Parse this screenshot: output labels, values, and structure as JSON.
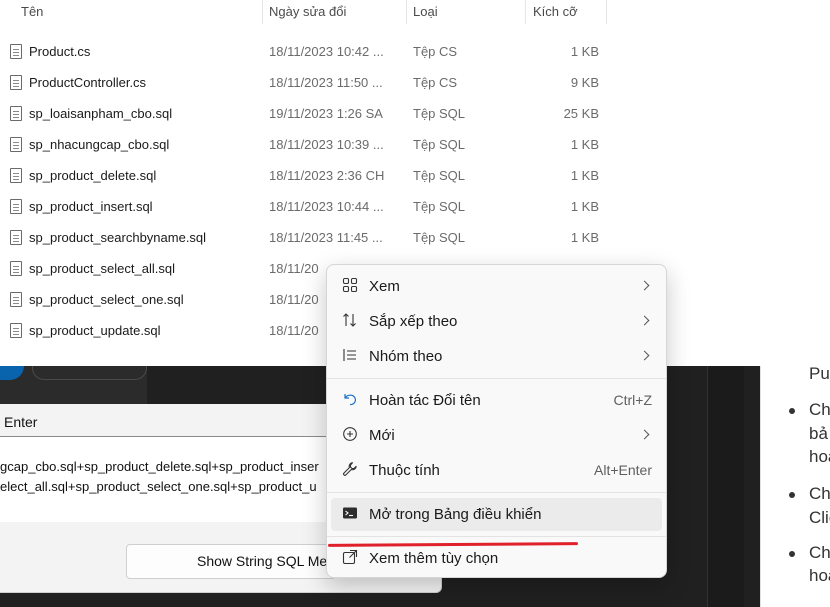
{
  "explorer": {
    "columns": {
      "name": "Tên",
      "date": "Ngày sửa đổi",
      "type": "Loại",
      "size": "Kích cỡ"
    },
    "files": [
      {
        "name": "Product.cs",
        "date": "18/11/2023 10:42 ...",
        "type": "Tệp CS",
        "size": "1 KB"
      },
      {
        "name": "ProductController.cs",
        "date": "18/11/2023 11:50 ...",
        "type": "Tệp CS",
        "size": "9 KB"
      },
      {
        "name": "sp_loaisanpham_cbo.sql",
        "date": "19/11/2023 1:26 SA",
        "type": "Tệp SQL",
        "size": "25 KB"
      },
      {
        "name": "sp_nhacungcap_cbo.sql",
        "date": "18/11/2023 10:39 ...",
        "type": "Tệp SQL",
        "size": "1 KB"
      },
      {
        "name": "sp_product_delete.sql",
        "date": "18/11/2023 2:36 CH",
        "type": "Tệp SQL",
        "size": "1 KB"
      },
      {
        "name": "sp_product_insert.sql",
        "date": "18/11/2023 10:44 ...",
        "type": "Tệp SQL",
        "size": "1 KB"
      },
      {
        "name": "sp_product_searchbyname.sql",
        "date": "18/11/2023 11:45 ...",
        "type": "Tệp SQL",
        "size": "1 KB"
      },
      {
        "name": "sp_product_select_all.sql",
        "date": "18/11/20",
        "type": "",
        "size": ""
      },
      {
        "name": "sp_product_select_one.sql",
        "date": "18/11/20",
        "type": "",
        "size": ""
      },
      {
        "name": "sp_product_update.sql",
        "date": "18/11/20",
        "type": "",
        "size": ""
      }
    ]
  },
  "context_menu": {
    "items": [
      {
        "icon": "grid-view-icon",
        "label": "Xem",
        "shortcut": "",
        "submenu": true
      },
      {
        "icon": "sort-icon",
        "label": "Sắp xếp theo",
        "shortcut": "",
        "submenu": true
      },
      {
        "icon": "group-icon",
        "label": "Nhóm theo",
        "shortcut": "",
        "submenu": true
      },
      {
        "icon": "undo-icon",
        "label": "Hoàn tác Đổi tên",
        "shortcut": "Ctrl+Z",
        "submenu": false
      },
      {
        "icon": "add-circle-icon",
        "label": "Mới",
        "shortcut": "",
        "submenu": true
      },
      {
        "icon": "wrench-icon",
        "label": "Thuộc tính",
        "shortcut": "Alt+Enter",
        "submenu": false
      },
      {
        "icon": "terminal-icon",
        "label": "Mở trong Bảng điều khiển",
        "shortcut": "",
        "submenu": false
      },
      {
        "icon": "open-external-icon",
        "label": "Xem thêm tùy chọn",
        "shortcut": "",
        "submenu": false
      }
    ],
    "highlighted_index": 6
  },
  "background_dialog": {
    "enter_label": "Enter",
    "text_line_1": "gcap_cbo.sql+sp_product_delete.sql+sp_product_inser",
    "text_line_2": "elect_all.sql+sp_product_select_one.sql+sp_product_u",
    "button_label": "Show String SQL Mer"
  },
  "right_doc": {
    "lines": [
      "Pul",
      "Ch",
      "bả",
      "hoa",
      "Ch",
      "Clic",
      "Ch",
      "hoa"
    ]
  },
  "colors": {
    "annotation_red": "#e0202a",
    "menu_highlight": "#ebebeb"
  }
}
